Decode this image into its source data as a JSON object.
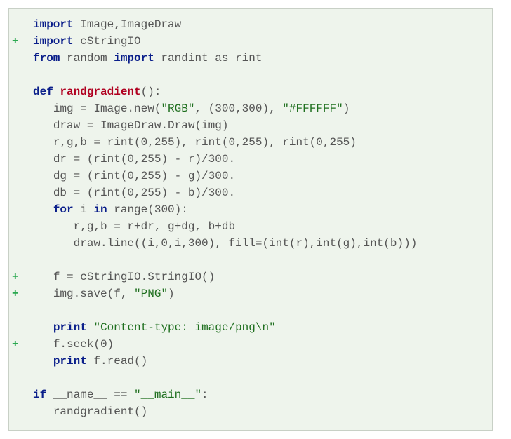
{
  "diff_marker": "+",
  "lines": [
    {
      "add": false,
      "indent": "",
      "tokens": [
        {
          "cls": "kw",
          "t": "import"
        },
        {
          "cls": "norm",
          "t": " Image,ImageDraw"
        }
      ]
    },
    {
      "add": true,
      "indent": "",
      "tokens": [
        {
          "cls": "kw",
          "t": "import"
        },
        {
          "cls": "norm",
          "t": " cStringIO"
        }
      ]
    },
    {
      "add": false,
      "indent": "",
      "tokens": [
        {
          "cls": "kw",
          "t": "from"
        },
        {
          "cls": "norm",
          "t": " random "
        },
        {
          "cls": "kw",
          "t": "import"
        },
        {
          "cls": "norm",
          "t": " randint as rint"
        }
      ]
    },
    {
      "add": false,
      "indent": "",
      "tokens": []
    },
    {
      "add": false,
      "indent": "",
      "tokens": [
        {
          "cls": "kw",
          "t": "def "
        },
        {
          "cls": "fname",
          "t": "randgradient"
        },
        {
          "cls": "norm",
          "t": "():"
        }
      ]
    },
    {
      "add": false,
      "indent": "   ",
      "tokens": [
        {
          "cls": "norm",
          "t": "img = Image.new("
        },
        {
          "cls": "str",
          "t": "\"RGB\""
        },
        {
          "cls": "norm",
          "t": ", (300,300), "
        },
        {
          "cls": "str",
          "t": "\"#FFFFFF\""
        },
        {
          "cls": "norm",
          "t": ")"
        }
      ]
    },
    {
      "add": false,
      "indent": "   ",
      "tokens": [
        {
          "cls": "norm",
          "t": "draw = ImageDraw.Draw(img)"
        }
      ]
    },
    {
      "add": false,
      "indent": "   ",
      "tokens": [
        {
          "cls": "norm",
          "t": "r,g,b = rint(0,255), rint(0,255), rint(0,255)"
        }
      ]
    },
    {
      "add": false,
      "indent": "   ",
      "tokens": [
        {
          "cls": "norm",
          "t": "dr = (rint(0,255) - r)/300."
        }
      ]
    },
    {
      "add": false,
      "indent": "   ",
      "tokens": [
        {
          "cls": "norm",
          "t": "dg = (rint(0,255) - g)/300."
        }
      ]
    },
    {
      "add": false,
      "indent": "   ",
      "tokens": [
        {
          "cls": "norm",
          "t": "db = (rint(0,255) - b)/300."
        }
      ]
    },
    {
      "add": false,
      "indent": "   ",
      "tokens": [
        {
          "cls": "kw",
          "t": "for"
        },
        {
          "cls": "norm",
          "t": " i "
        },
        {
          "cls": "kw",
          "t": "in"
        },
        {
          "cls": "norm",
          "t": " range(300):"
        }
      ]
    },
    {
      "add": false,
      "indent": "      ",
      "tokens": [
        {
          "cls": "norm",
          "t": "r,g,b = r+dr, g+dg, b+db"
        }
      ]
    },
    {
      "add": false,
      "indent": "      ",
      "tokens": [
        {
          "cls": "norm",
          "t": "draw.line((i,0,i,300), fill=(int(r),int(g),int(b)))"
        }
      ]
    },
    {
      "add": false,
      "indent": "",
      "tokens": []
    },
    {
      "add": true,
      "indent": "   ",
      "tokens": [
        {
          "cls": "norm",
          "t": "f = cStringIO.StringIO()"
        }
      ]
    },
    {
      "add": true,
      "indent": "   ",
      "tokens": [
        {
          "cls": "norm",
          "t": "img.save(f, "
        },
        {
          "cls": "str",
          "t": "\"PNG\""
        },
        {
          "cls": "norm",
          "t": ")"
        }
      ]
    },
    {
      "add": false,
      "indent": "",
      "tokens": []
    },
    {
      "add": false,
      "indent": "   ",
      "tokens": [
        {
          "cls": "kw",
          "t": "print"
        },
        {
          "cls": "norm",
          "t": " "
        },
        {
          "cls": "str",
          "t": "\"Content-type: image/png\\n\""
        }
      ]
    },
    {
      "add": true,
      "indent": "   ",
      "tokens": [
        {
          "cls": "norm",
          "t": "f.seek(0)"
        }
      ]
    },
    {
      "add": false,
      "indent": "   ",
      "tokens": [
        {
          "cls": "kw",
          "t": "print"
        },
        {
          "cls": "norm",
          "t": " f.read()"
        }
      ]
    },
    {
      "add": false,
      "indent": "",
      "tokens": []
    },
    {
      "add": false,
      "indent": "",
      "tokens": [
        {
          "cls": "kw",
          "t": "if"
        },
        {
          "cls": "norm",
          "t": " __name__ == "
        },
        {
          "cls": "str",
          "t": "\"__main__\""
        },
        {
          "cls": "norm",
          "t": ":"
        }
      ]
    },
    {
      "add": false,
      "indent": "   ",
      "tokens": [
        {
          "cls": "norm",
          "t": "randgradient()"
        }
      ]
    }
  ]
}
